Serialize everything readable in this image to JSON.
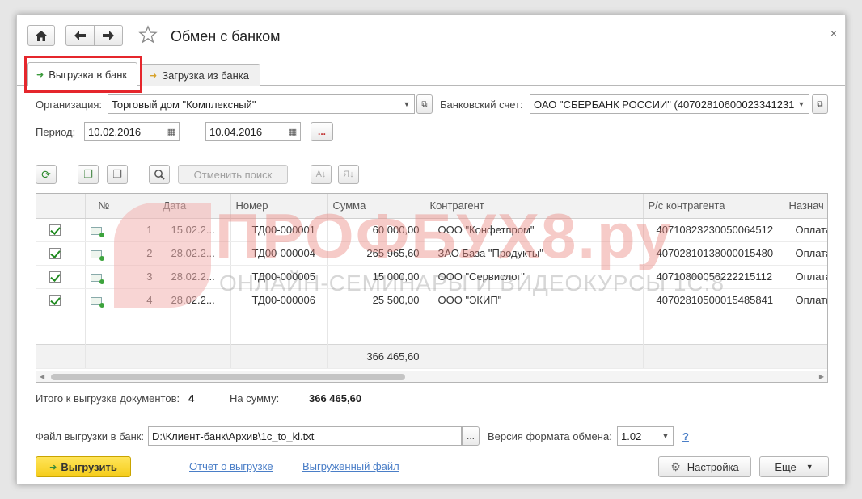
{
  "window": {
    "title": "Обмен с банком",
    "close": "×"
  },
  "tabs": [
    {
      "label": "Выгрузка в банк",
      "active": true
    },
    {
      "label": "Загрузка из банка",
      "active": false
    }
  ],
  "form": {
    "org_label": "Организация:",
    "org_value": "Торговый дом \"Комплексный\"",
    "bank_label": "Банковский счет:",
    "bank_value": "ОАО \"СБЕРБАНК РОССИИ\" (40702810600023341231",
    "period_label": "Период:",
    "period_from": "10.02.2016",
    "period_dash": "–",
    "period_to": "10.04.2016",
    "period_more": "..."
  },
  "toolbar": {
    "cancel_search": "Отменить поиск"
  },
  "table": {
    "columns": [
      "",
      "№",
      "Дата",
      "Номер",
      "Сумма",
      "Контрагент",
      "Р/с контрагента",
      "Назнач"
    ],
    "rows": [
      {
        "n": "1",
        "date": "15.02.2...",
        "num": "ТД00-000001",
        "sum": "60 000,00",
        "contractor": "ООО \"Конфетпром\"",
        "account": "40710823230050064512",
        "purpose": "Оплата"
      },
      {
        "n": "2",
        "date": "28.02.2...",
        "num": "ТД00-000004",
        "sum": "265 965,60",
        "contractor": "ЗАО База \"Продукты\"",
        "account": "40702810138000015480",
        "purpose": "Оплата"
      },
      {
        "n": "3",
        "date": "28.02.2...",
        "num": "ТД00-000005",
        "sum": "15 000,00",
        "contractor": "ООО \"Сервислог\"",
        "account": "40710800056222215112",
        "purpose": "Оплата"
      },
      {
        "n": "4",
        "date": "28.02.2...",
        "num": "ТД00-000006",
        "sum": "25 500,00",
        "contractor": "ООО \"ЭКИП\"",
        "account": "40702810500015485841",
        "purpose": "Оплата"
      }
    ],
    "total_sum": "366 465,60"
  },
  "watermark": {
    "main": "ПРОФБУХ8.ру",
    "sub": "ОНЛАЙН-СЕМИНАРЫ И ВИДЕОКУРСЫ 1С:8"
  },
  "summary": {
    "docs_label": "Итого к выгрузке документов:",
    "docs_count": "4",
    "sum_label": "На сумму:",
    "sum_value": "366 465,60"
  },
  "file": {
    "label": "Файл выгрузки в банк:",
    "value": "D:\\Клиент-банк\\Архив\\1c_to_kl.txt",
    "browse": "...",
    "version_label": "Версия формата обмена:",
    "version_value": "1.02",
    "help": "?"
  },
  "footer": {
    "export_button": "Выгрузить",
    "report_link": "Отчет о выгрузке",
    "file_link": "Выгруженный файл",
    "settings_button": "Настройка",
    "more_button": "Еще"
  }
}
